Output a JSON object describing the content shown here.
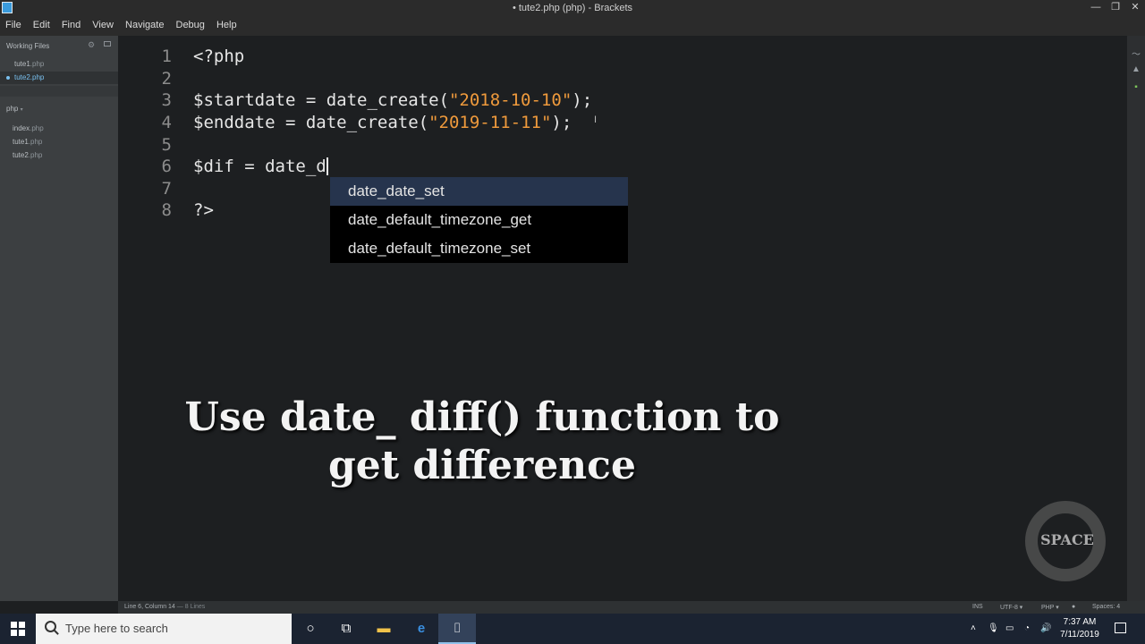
{
  "window": {
    "title": "• tute2.php (php) - Brackets"
  },
  "menu": [
    "File",
    "Edit",
    "Find",
    "View",
    "Navigate",
    "Debug",
    "Help"
  ],
  "sidebar": {
    "working_files_label": "Working Files",
    "working_files": [
      {
        "name": "tute1",
        "ext": ".php"
      },
      {
        "name": "tute2",
        "ext": ".php"
      }
    ],
    "project_label": "php",
    "tree": [
      {
        "name": "index",
        "ext": ".php"
      },
      {
        "name": "tute1",
        "ext": ".php"
      },
      {
        "name": "tute2",
        "ext": ".php"
      }
    ]
  },
  "editor": {
    "line_numbers": [
      "1",
      "2",
      "3",
      "4",
      "5",
      "6",
      "7",
      "8"
    ],
    "lines": [
      {
        "pre": "<?php"
      },
      {
        "pre": ""
      },
      {
        "pre": "$startdate = date_create(",
        "str": "\"2018-10-10\"",
        "post": ");"
      },
      {
        "pre": "$enddate = date_create(",
        "str": "\"2019-11-11\"",
        "post": ");"
      },
      {
        "pre": ""
      },
      {
        "pre": "$dif = date_d"
      },
      {
        "pre": ""
      },
      {
        "pre": "?>"
      }
    ],
    "hints": [
      "date_date_set",
      "date_default_timezone_get",
      "date_default_timezone_set"
    ]
  },
  "overlay": {
    "caption": "Use date_ diff() function to get difference",
    "logo_text": "SPACE"
  },
  "statusbar": {
    "position": "Line 6, Column 14",
    "lines": "8 Lines",
    "ins": "INS",
    "encoding": "UTF-8",
    "language": "PHP",
    "spaces": "Spaces: 4"
  },
  "taskbar": {
    "search_placeholder": "Type here to search",
    "time": "7:37 AM",
    "date": "7/11/2019"
  }
}
